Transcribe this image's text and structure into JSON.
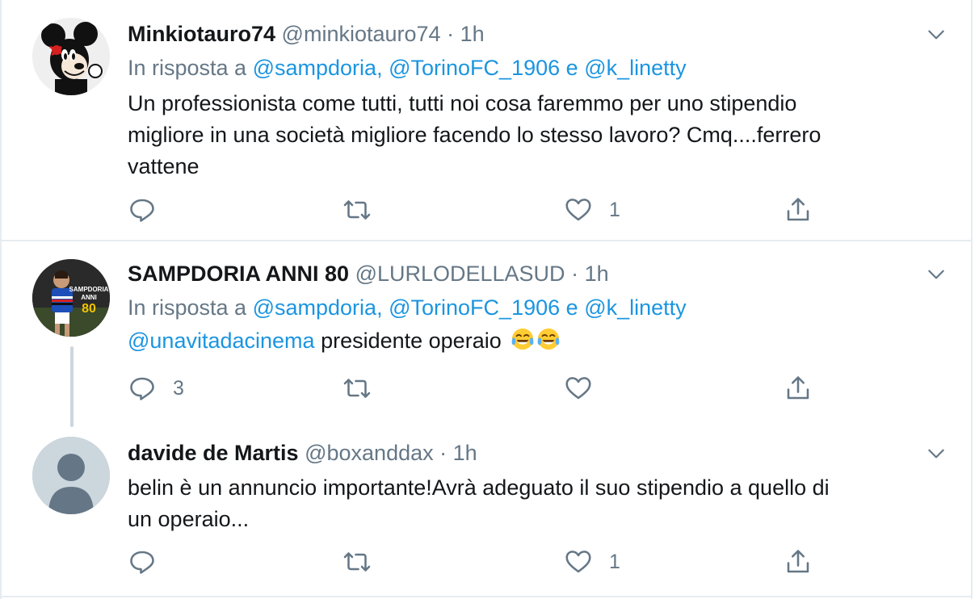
{
  "colors": {
    "link": "#1b95e0",
    "muted": "#657786",
    "text": "#14171a",
    "border": "#e6ecf0"
  },
  "tweets": [
    {
      "name": "Minkiotauro74",
      "handle": "@minkiotauro74",
      "dot": "·",
      "time": "1h",
      "reply_prefix": "In risposta a",
      "mention1": "@sampdoria",
      "comma": ",",
      "mention2": "@TorinoFC_1906",
      "conj": "e",
      "mention3": "@k_linetty",
      "text_line1": "Un professionista come tutti, tutti noi cosa faremmo per uno stipendio",
      "text_line2": "migliore in una società migliore facendo lo stesso lavoro? Cmq....ferrero",
      "text_line3": "vattene",
      "replies": "",
      "retweets": "",
      "likes": "1",
      "avatar_icon": "mickey-mouse-avatar"
    },
    {
      "name": "SAMPDORIA ANNI 80",
      "handle": "@LURLODELLASUD",
      "dot": "·",
      "time": "1h",
      "reply_prefix": "In risposta a",
      "mention1": "@sampdoria",
      "comma": ",",
      "mention2": "@TorinoFC_1906",
      "conj": "e",
      "mention3": "@k_linetty",
      "text_mention": "@unavitadacinema",
      "text": "presidente operaio",
      "emoji": [
        "tears-of-joy-emoji",
        "tears-of-joy-emoji"
      ],
      "avatar_text1": "SAMPDORIA",
      "avatar_text2": "ANNI",
      "avatar_text3": "80",
      "replies": "3",
      "retweets": "",
      "likes": ""
    },
    {
      "name": "davide de Martis",
      "handle": "@boxanddax",
      "dot": "·",
      "time": "1h",
      "text_line1": "belin è un annuncio importante!Avrà adeguato il suo stipendio a quello di",
      "text_line2": "un operaio...",
      "replies": "",
      "retweets": "",
      "likes": "1",
      "avatar_icon": "default-profile-avatar"
    }
  ]
}
